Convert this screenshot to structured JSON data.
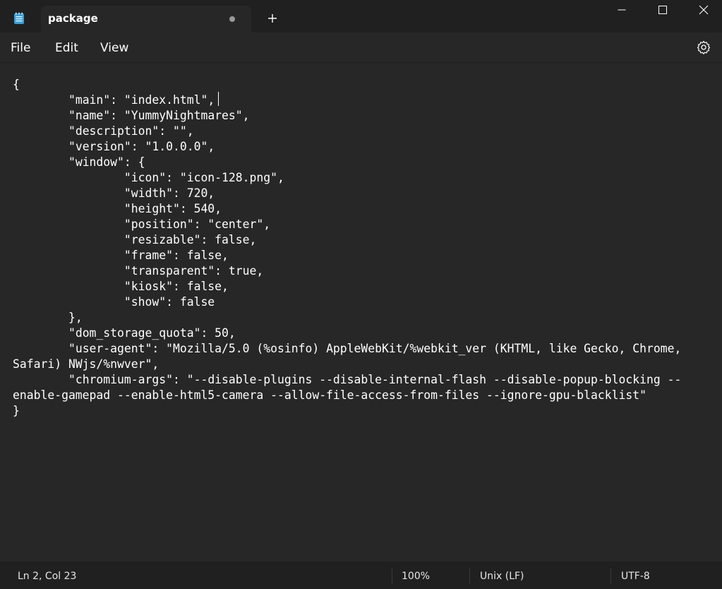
{
  "window": {
    "tab_title": "package",
    "tab_unsaved": true
  },
  "menu": {
    "file": "File",
    "edit": "Edit",
    "view": "View"
  },
  "editor": {
    "lines": [
      "{",
      "\t\"main\": \"index.html\",",
      "\t\"name\": \"YummyNightmares\",",
      "\t\"description\": \"\",",
      "\t\"version\": \"1.0.0.0\",",
      "\t\"window\": {",
      "\t\t\"icon\": \"icon-128.png\",",
      "\t\t\"width\": 720,",
      "\t\t\"height\": 540,",
      "\t\t\"position\": \"center\",",
      "\t\t\"resizable\": false,",
      "\t\t\"frame\": false,",
      "\t\t\"transparent\": true,",
      "\t\t\"kiosk\": false,",
      "\t\t\"show\": false",
      "\t},",
      "\t\"dom_storage_quota\": 50,",
      "\t\"user-agent\": \"Mozilla/5.0 (%osinfo) AppleWebKit/%webkit_ver (KHTML, like Gecko, Chrome,",
      "Safari) NWjs/%nwver\",",
      "\t\"chromium-args\": \"--disable-plugins --disable-internal-flash --disable-popup-blocking --",
      "enable-gamepad --enable-html5-camera --allow-file-access-from-files --ignore-gpu-blacklist\"",
      "}"
    ]
  },
  "status": {
    "position": "Ln 2, Col 23",
    "zoom": "100%",
    "line_ending": "Unix (LF)",
    "encoding": "UTF-8"
  },
  "colors": {
    "titlebar": "#202020",
    "editor_bg": "#272727",
    "text": "#ffffff",
    "notepad_icon": "#3aa0d8"
  },
  "icons": {
    "app": "notepad-icon",
    "new_tab": "plus-icon",
    "minimize": "minimize-icon",
    "maximize": "maximize-icon",
    "close": "close-icon",
    "settings": "gear-icon"
  }
}
